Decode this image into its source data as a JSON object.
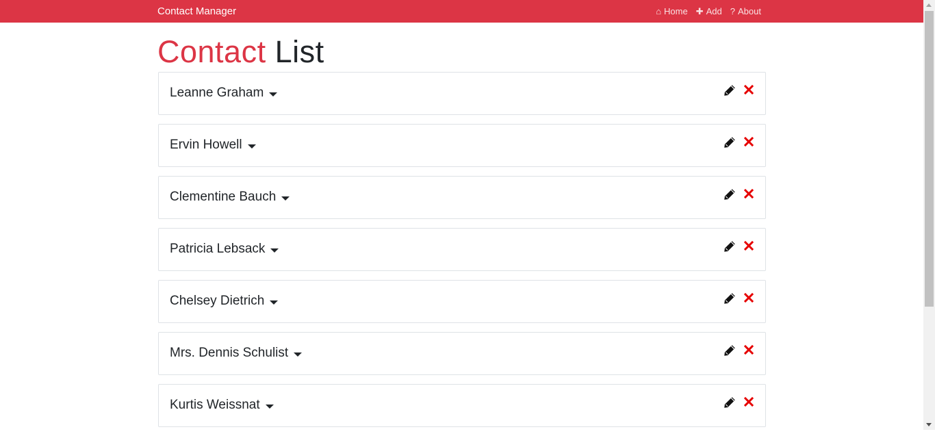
{
  "navbar": {
    "brand": "Contact Manager",
    "links": [
      {
        "label": "Home",
        "icon": "home-icon"
      },
      {
        "label": "Add",
        "icon": "plus-icon"
      },
      {
        "label": "About",
        "icon": "question-icon"
      }
    ]
  },
  "page": {
    "title_part1": "Contact",
    "title_part2": "List"
  },
  "colors": {
    "brand": "#dc3545",
    "delete": "#e60000"
  },
  "contacts": [
    {
      "name": "Leanne Graham"
    },
    {
      "name": "Ervin Howell"
    },
    {
      "name": "Clementine Bauch"
    },
    {
      "name": "Patricia Lebsack"
    },
    {
      "name": "Chelsey Dietrich"
    },
    {
      "name": "Mrs. Dennis Schulist"
    },
    {
      "name": "Kurtis Weissnat"
    }
  ]
}
